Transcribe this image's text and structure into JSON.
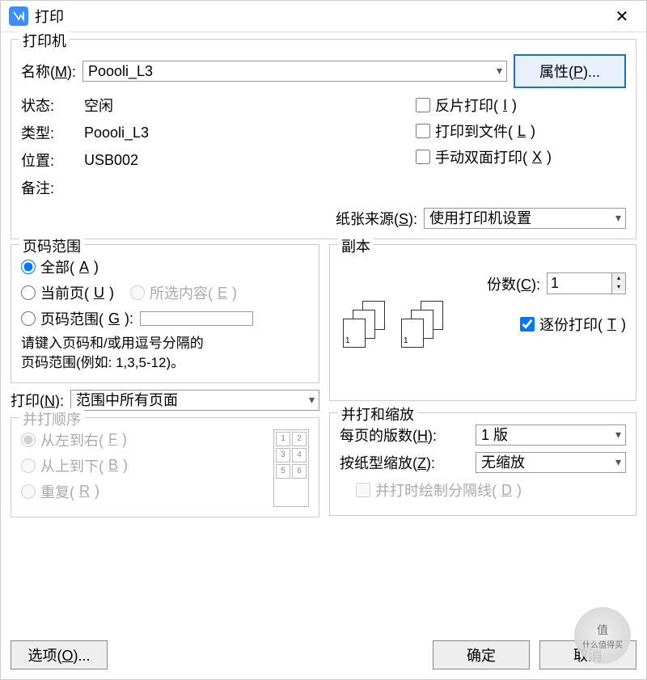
{
  "window": {
    "title": "打印"
  },
  "printer": {
    "legend": "打印机",
    "name_label": "名称(M):",
    "name_value": "Poooli_L3",
    "properties_btn": "属性(P)...",
    "status_label": "状态:",
    "status_value": "空闲",
    "type_label": "类型:",
    "type_value": "Poooli_L3",
    "where_label": "位置:",
    "where_value": "USB002",
    "comment_label": "备注:",
    "invert_label": "反片打印(I)",
    "to_file_label": "打印到文件(L)",
    "manual_duplex_label": "手动双面打印(X)",
    "paper_source_label": "纸张来源(S):",
    "paper_source_value": "使用打印机设置"
  },
  "range": {
    "legend": "页码范围",
    "all": "全部(A)",
    "current": "当前页(U)",
    "selection": "所选内容(E)",
    "pages": "页码范围(G):",
    "pages_value": "",
    "hint1": "请键入页码和/或用逗号分隔的",
    "hint2": "页码范围(例如: 1,3,5-12)。",
    "print_label": "打印(N):",
    "print_value": "范围中所有页面",
    "order_legend": "并打顺序",
    "lr": "从左到右(F)",
    "tb": "从上到下(B)",
    "repeat": "重复(R)"
  },
  "copies": {
    "legend": "副本",
    "count_label": "份数(C):",
    "count_value": "1",
    "collate_label": "逐份打印(T)"
  },
  "scaling": {
    "legend": "并打和缩放",
    "per_sheet_label": "每页的版数(H):",
    "per_sheet_value": "1 版",
    "scale_label": "按纸型缩放(Z):",
    "scale_value": "无缩放",
    "divider_label": "并打时绘制分隔线(D)"
  },
  "buttons": {
    "options": "选项(O)...",
    "ok": "确定",
    "cancel": "取消"
  },
  "watermark": {
    "brand": "值",
    "sub": "什么值得买"
  }
}
